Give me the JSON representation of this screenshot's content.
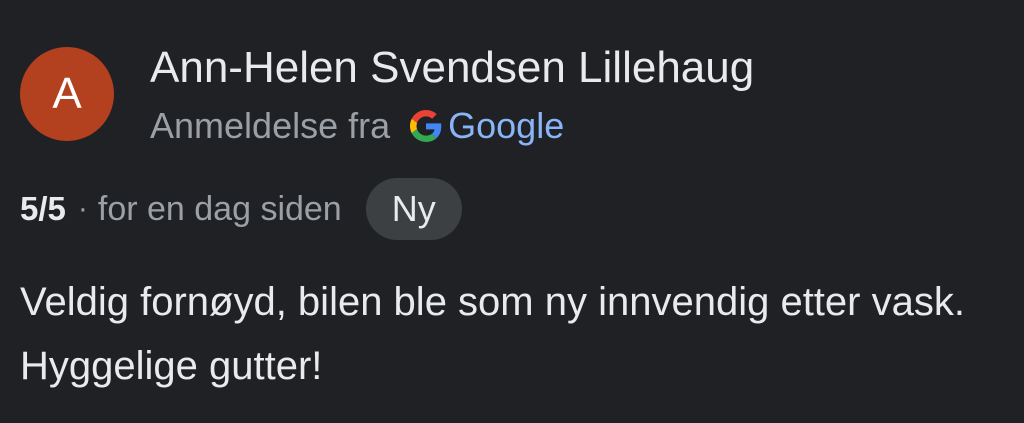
{
  "review": {
    "avatar_letter": "A",
    "reviewer_name": "Ann-Helen Svendsen Lillehaug",
    "source_prefix": "Anmeldelse fra",
    "source_name": "Google",
    "rating": "5/5",
    "separator": "·",
    "time_ago": "for en dag siden",
    "badge": "Ny",
    "text": "Veldig fornøyd, bilen ble som ny innvendig etter vask. Hyggelige gutter!"
  },
  "colors": {
    "background": "#202124",
    "avatar": "#b3401f",
    "link_blue": "#8ab4f8",
    "badge_bg": "#3c4043"
  },
  "icons": {
    "source": "google-g-icon"
  }
}
